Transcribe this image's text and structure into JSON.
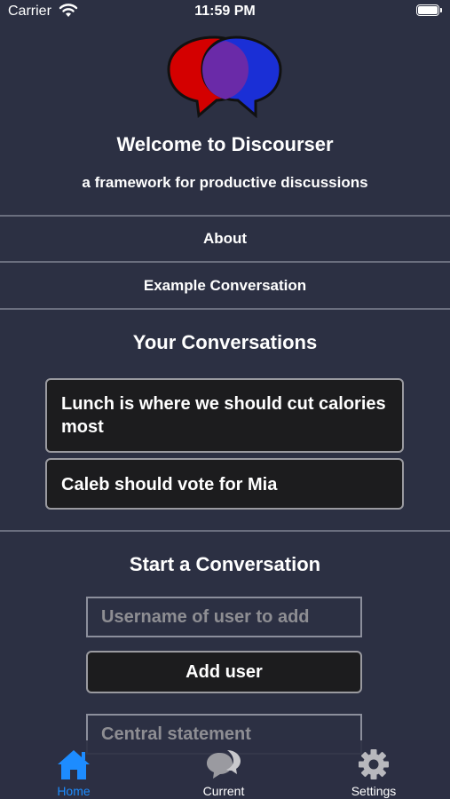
{
  "status_bar": {
    "carrier": "Carrier",
    "time": "11:59 PM",
    "wifi_icon": "wifi-icon",
    "battery_icon": "battery-icon"
  },
  "header": {
    "logo_icon": "speech-bubbles-logo",
    "title": "Welcome to Discourser",
    "subtitle": "a framework for productive discussions"
  },
  "menu": {
    "about": "About",
    "example": "Example Conversation"
  },
  "conversations": {
    "title": "Your Conversations",
    "items": [
      {
        "label": "Lunch is where we should cut calories most"
      },
      {
        "label": "Caleb should vote for Mia"
      }
    ]
  },
  "start": {
    "title": "Start a Conversation",
    "username_placeholder": "Username of user to add",
    "add_user_label": "Add user",
    "central_placeholder": "Central statement"
  },
  "tab_bar": {
    "home": {
      "label": "Home",
      "icon": "home-icon",
      "active": true
    },
    "current": {
      "label": "Current",
      "icon": "chat-bubbles-icon",
      "active": false
    },
    "settings": {
      "label": "Settings",
      "icon": "gear-icon",
      "active": false
    }
  },
  "colors": {
    "background": "#2c3043",
    "card": "#1c1c1e",
    "accent": "#1d8cff",
    "logo_red": "#d40000",
    "logo_blue": "#1a2fd6",
    "logo_purple": "#6a2aa8"
  }
}
